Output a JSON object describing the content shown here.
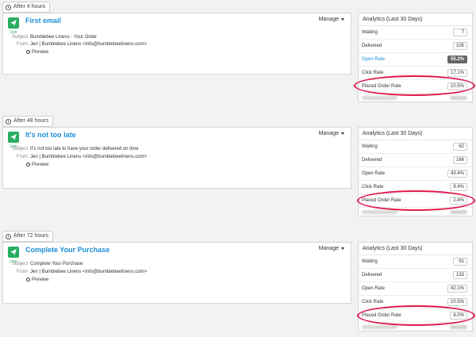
{
  "analytics_title": "Analytics (Last 30 Days)",
  "manage_label": "Manage",
  "preview_label": "Preview",
  "live_label": "Live",
  "subject_key": "Subject",
  "from_key": "From",
  "accent_color": "#1e8fd6",
  "highlight_color": "#e0174b",
  "steps": [
    {
      "delay": "After 4 hours",
      "title": "First email",
      "subject": "Bumblebee Linens - Your Order",
      "from": "Jen | Bumblebee Linens <info@bumblebeelinens.com>",
      "stats": [
        {
          "label": "Waiting",
          "value": "7"
        },
        {
          "label": "Delivered",
          "value": "105"
        },
        {
          "label": "Open Rate",
          "value": "55.2%",
          "highlighted": true
        },
        {
          "label": "Click Rate",
          "value": "17.1%"
        },
        {
          "label": "Placed Order Rate",
          "value": "10.5%"
        }
      ]
    },
    {
      "delay": "After 48 hours",
      "title": "It's not too late",
      "subject": "It's not too late to have your order delivered on time",
      "from": "Jen | Bumblebee Linens <info@bumblebeelinens.com>",
      "stats": [
        {
          "label": "Waiting",
          "value": "62"
        },
        {
          "label": "Delivered",
          "value": "166"
        },
        {
          "label": "Open Rate",
          "value": "43.4%"
        },
        {
          "label": "Click Rate",
          "value": "8.4%"
        },
        {
          "label": "Placed Order Rate",
          "value": "2.4%"
        }
      ]
    },
    {
      "delay": "After 72 hours",
      "title": "Complete Your Purchase",
      "subject": "Complete Your Purchase",
      "from": "Jen | Bumblebee Linens <info@bumblebeelinens.com>",
      "stats": [
        {
          "label": "Waiting",
          "value": "91"
        },
        {
          "label": "Delivered",
          "value": "133"
        },
        {
          "label": "Open Rate",
          "value": "42.1%"
        },
        {
          "label": "Click Rate",
          "value": "10.5%"
        },
        {
          "label": "Placed Order Rate",
          "value": "6.0%"
        }
      ]
    }
  ]
}
